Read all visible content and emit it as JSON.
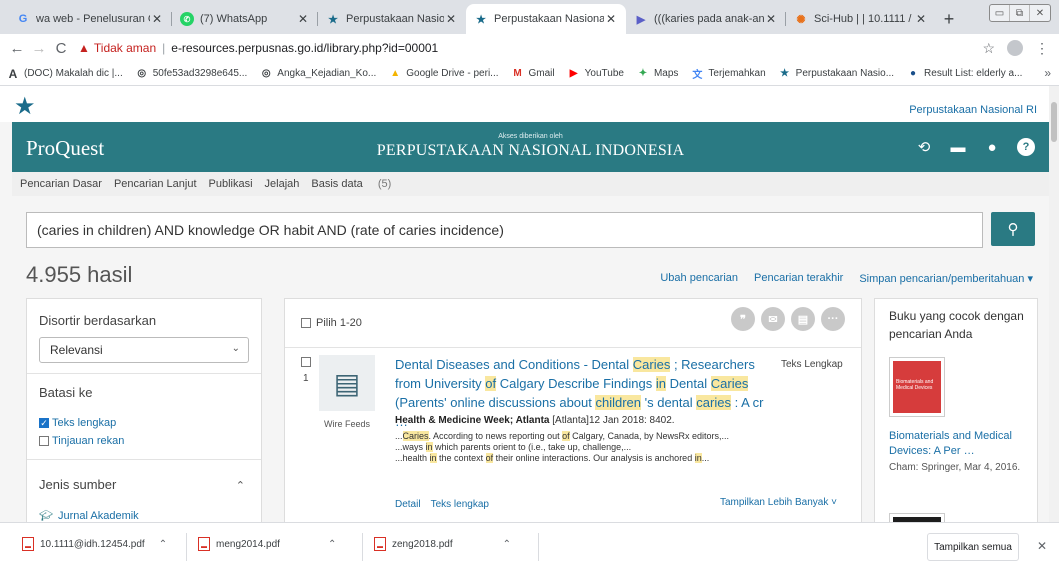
{
  "browser": {
    "tabs": [
      {
        "title": "wa web - Penelusuran G",
        "icon": "google-icon",
        "active": false
      },
      {
        "title": "(7) WhatsApp",
        "icon": "whatsapp-icon",
        "active": false
      },
      {
        "title": "Perpustakaan Nasional R",
        "icon": "star-icon",
        "active": false
      },
      {
        "title": "Perpustakaan Nasional R",
        "icon": "star-icon",
        "active": true
      },
      {
        "title": "(((karies pada anak-anak",
        "icon": "scholar-icon",
        "active": false
      },
      {
        "title": "Sci-Hub | | 10.1111 / idh.",
        "icon": "scihub-icon",
        "active": false
      }
    ],
    "not_secure": "Tidak aman",
    "url": "e-resources.perpusnas.go.id/library.php?id=00001",
    "bookmarks": [
      "(DOC) Makalah dic |...",
      "50fe53ad3298e645...",
      "Angka_Kejadian_Ko...",
      "Google Drive - peri...",
      "Gmail",
      "YouTube",
      "Maps",
      "Terjemahkan",
      "Perpustakaan Nasio...",
      "Result List: elderly a..."
    ]
  },
  "site": {
    "top_link": "Perpustakaan Nasional RI",
    "logo": "ProQuest",
    "access_by": "Akses diberikan oleh",
    "institution": "PERPUSTAKAAN NASIONAL INDONESIA",
    "nav": [
      "Pencarian Dasar",
      "Pencarian Lanjut",
      "Publikasi",
      "Jelajah",
      "Basis data"
    ],
    "nav_db_count": "(5)",
    "search_query": "(caries in children) AND knowledge OR habit AND (rate of caries incidence)",
    "results_count": "4.955 hasil",
    "links": [
      "Ubah pencarian",
      "Pencarian terakhir",
      "Simpan pencarian/pemberitahuan ▾"
    ]
  },
  "left": {
    "sort_heading": "Disortir berdasarkan",
    "sort_value": "Relevansi",
    "limit_heading": "Batasi ke",
    "full_text": "Teks lengkap",
    "peer_reviewed": "Tinjauan rekan",
    "source_heading": "Jenis sumber",
    "source_item": "Jurnal Akademik"
  },
  "results": {
    "select_label": "Pilih 1-20",
    "item": {
      "number": "1",
      "type_label": "Wire Feeds",
      "full_text_badge": "Teks Lengkap",
      "title_parts": [
        {
          "t": "Dental Diseases and Conditions - Dental ",
          "h": false
        },
        {
          "t": "Caries",
          "h": true
        },
        {
          "t": " ; Researchers from University ",
          "h": false
        },
        {
          "t": "of",
          "h": true
        },
        {
          "t": " Calgary Describe Findings ",
          "h": false
        },
        {
          "t": "in",
          "h": true
        },
        {
          "t": " Dental ",
          "h": false
        },
        {
          "t": "Caries",
          "h": true
        },
        {
          "t": " (Parents' online discussions about ",
          "h": false
        },
        {
          "t": "children",
          "h": true
        },
        {
          "t": " 's dental ",
          "h": false
        },
        {
          "t": "caries",
          "h": true
        },
        {
          "t": " : A cr …",
          "h": false
        }
      ],
      "source": "Health & Medicine Week; Atlanta",
      "source_rest": " [Atlanta]12 Jan 2018: 8402.",
      "snippets": [
        [
          {
            "t": "...",
            "h": false
          },
          {
            "t": "Caries",
            "h": true
          },
          {
            "t": ". According to news reporting out ",
            "h": false
          },
          {
            "t": "of",
            "h": true
          },
          {
            "t": " Calgary, Canada, by NewsRx editors,...",
            "h": false
          }
        ],
        [
          {
            "t": "...ways ",
            "h": false
          },
          {
            "t": "in",
            "h": true
          },
          {
            "t": " which parents orient to (i.e., take up, challenge,...",
            "h": false
          }
        ],
        [
          {
            "t": "...health ",
            "h": false
          },
          {
            "t": "in",
            "h": true
          },
          {
            "t": " the context ",
            "h": false
          },
          {
            "t": "of",
            "h": true
          },
          {
            "t": " their online interactions. Our analysis is anchored ",
            "h": false
          },
          {
            "t": "in",
            "h": true
          },
          {
            "t": "...",
            "h": false
          }
        ]
      ],
      "detail": "Detail",
      "full_text_link": "Teks lengkap",
      "show_more": "Tampilkan Lebih Banyak ˅"
    }
  },
  "right": {
    "heading": "Buku yang cocok dengan pencarian Anda",
    "cover_text": "Biomaterials and Medical Devices",
    "book_title": "Biomaterials and Medical Devices: A Per …",
    "book_meta": "Cham: Springer, Mar 4, 2016."
  },
  "downloads": {
    "files": [
      "10.1111@idh.12454.pdf",
      "meng2014.pdf",
      "zeng2018.pdf"
    ],
    "show_all": "Tampilkan semua"
  }
}
